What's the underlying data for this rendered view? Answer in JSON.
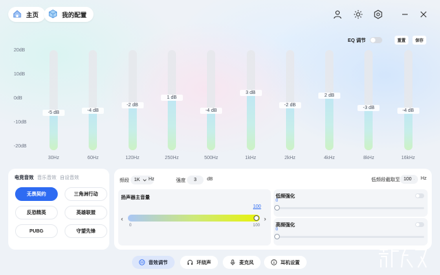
{
  "header": {
    "home_label": "主页",
    "config_label": "我的配置"
  },
  "eq": {
    "toggle_label": "EQ 调节",
    "reset_label": "重置",
    "save_label": "保存",
    "y_ticks": [
      "20dB",
      "10dB",
      "0dB",
      "-10dB",
      "-20dB"
    ],
    "bands": [
      {
        "freq": "30Hz",
        "value": -5,
        "label": "-5 dB"
      },
      {
        "freq": "60Hz",
        "value": -4,
        "label": "-4 dB"
      },
      {
        "freq": "120Hz",
        "value": -2,
        "label": "-2 dB"
      },
      {
        "freq": "250Hz",
        "value": 1,
        "label": "1 dB"
      },
      {
        "freq": "500Hz",
        "value": -4,
        "label": "-4 dB"
      },
      {
        "freq": "1kHz",
        "value": 3,
        "label": "3 dB"
      },
      {
        "freq": "2kHz",
        "value": -2,
        "label": "-2 dB"
      },
      {
        "freq": "4kHz",
        "value": 2,
        "label": "2 dB"
      },
      {
        "freq": "8kHz",
        "value": -3,
        "label": "-3 dB"
      },
      {
        "freq": "16kHz",
        "value": -4,
        "label": "-4 dB"
      }
    ],
    "colors": {
      "fill_top": "#bfe6f4",
      "fill_bottom": "#ccf2c4"
    }
  },
  "presets": {
    "tabs": [
      "电竞音效",
      "音乐音效",
      "自设音效"
    ],
    "buttons": [
      "无畏契约",
      "三角洲行动",
      "反恐精英",
      "英雄联盟",
      "PUBG",
      "守望先锋"
    ],
    "active": "无畏契约",
    "accent": "#2e6bf2"
  },
  "settings": {
    "freq_label": "频段",
    "freq_value": "1K",
    "freq_unit": "Hz",
    "strength_label": "强度",
    "strength_value": "3",
    "strength_unit": "dB",
    "lowfreq_label": "低频段截取至",
    "lowfreq_value": "100",
    "lowfreq_unit": "Hz",
    "volume_title": "扬声器主音量",
    "volume_value": "100",
    "volume_min": "0",
    "volume_max": "100",
    "volume_level": 1.0,
    "bass_title": "低频强化",
    "bass_value": "0",
    "treble_title": "高频强化",
    "treble_value": "0"
  },
  "nav": {
    "items": [
      "音效调节",
      "环绕声",
      "麦克风",
      "耳机设置"
    ],
    "active": "音效调节"
  }
}
